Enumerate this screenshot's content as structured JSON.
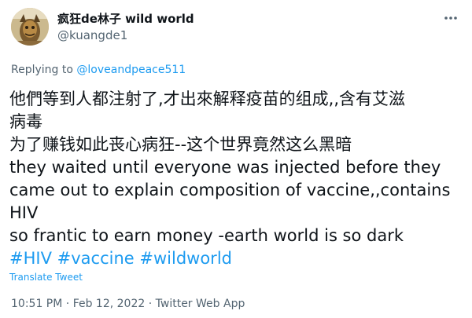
{
  "author": {
    "display_name": "疯狂de林子 wild world",
    "handle": "@kuangde1",
    "avatar_icon": "avatar-portrait-icon"
  },
  "reply": {
    "prefix": "Replying to",
    "to_handle": "@loveandpeace511"
  },
  "tweet": {
    "lines": [
      "他們等到人都注射了,才出來解释疫苗的组成,,含有艾滋",
      "病毒",
      "为了赚钱如此丧心病狂--这个世界竟然这么黑暗",
      "they waited until everyone was injected before they",
      "came out to explain composition of vaccine,,contains",
      "HIV",
      "so frantic to earn money -earth world is so dark"
    ],
    "hashtags": [
      "#HIV",
      "#vaccine",
      "#wildworld"
    ]
  },
  "translate_label": "Translate Tweet",
  "meta": {
    "time": "10:51 PM",
    "separator": " · ",
    "date": "Feb 12, 2022",
    "source": "Twitter Web App"
  },
  "colors": {
    "link": "#1d9bf0",
    "secondary_text": "#536471",
    "primary_text": "#0f1419"
  }
}
